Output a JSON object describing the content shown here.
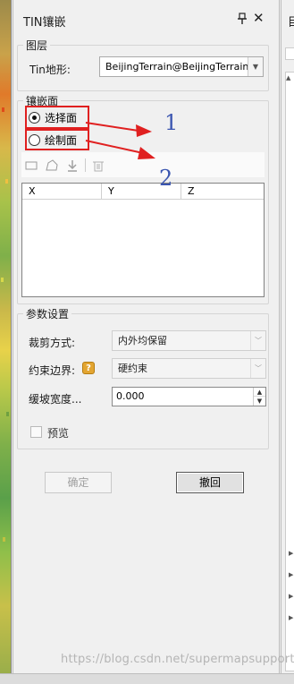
{
  "panel": {
    "title": "TIN镶嵌"
  },
  "layer_group": {
    "legend": "图层",
    "tin_label": "Tin地形:",
    "tin_value": "BeijingTerrain@BeijingTerrain"
  },
  "mosaic_group": {
    "legend": "镶嵌面",
    "radio_select": {
      "label": "选择面",
      "checked": true
    },
    "radio_draw": {
      "label": "绘制面",
      "checked": false
    },
    "toolbar_icons": [
      "rectangle-icon",
      "polygon-icon",
      "import-icon",
      "delete-icon"
    ],
    "grid_columns": [
      "X",
      "Y",
      "Z"
    ]
  },
  "params_group": {
    "legend": "参数设置",
    "clip_label": "裁剪方式:",
    "clip_value": "内外均保留",
    "boundary_label": "约束边界:",
    "boundary_value": "硬约束",
    "slope_label": "缓坡宽度...",
    "slope_value": "0.000",
    "preview_label": "预览"
  },
  "buttons": {
    "ok": "确定",
    "undo": "撤回"
  },
  "annotations": {
    "one": "1",
    "two": "2"
  },
  "right_panel": {
    "title_char": "目"
  },
  "watermark": "https://blog.csdn.net/supermapsupport",
  "colors": {
    "annotation_red": "#e02020",
    "annotation_blue": "#3a55b0",
    "help_icon": "#e3a531"
  }
}
